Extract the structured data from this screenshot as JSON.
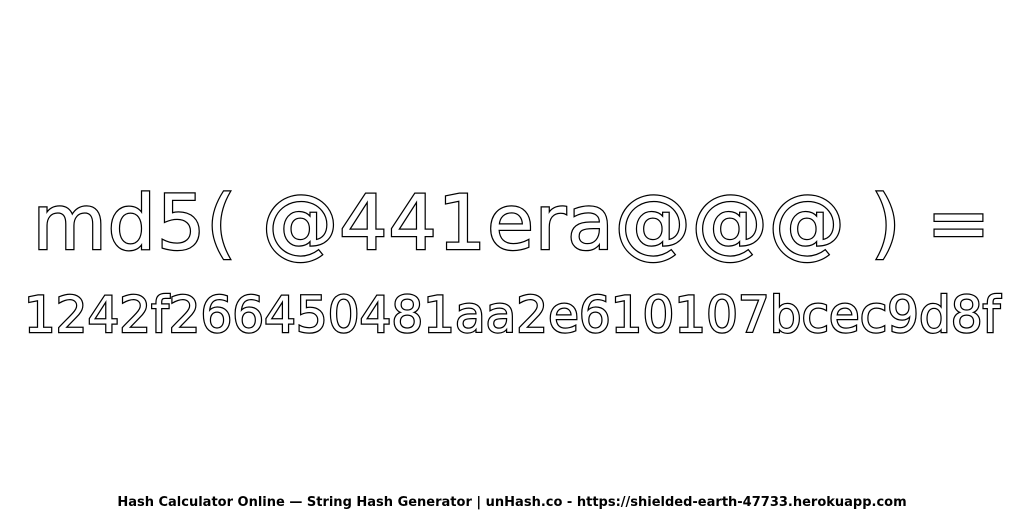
{
  "expression": "md5( @441era@@@ ) =",
  "hash": "1242f266450481aa2e610107bcec9d8f",
  "footer": "Hash Calculator Online — String Hash Generator | unHash.co - https://shielded-earth-47733.herokuapp.com"
}
